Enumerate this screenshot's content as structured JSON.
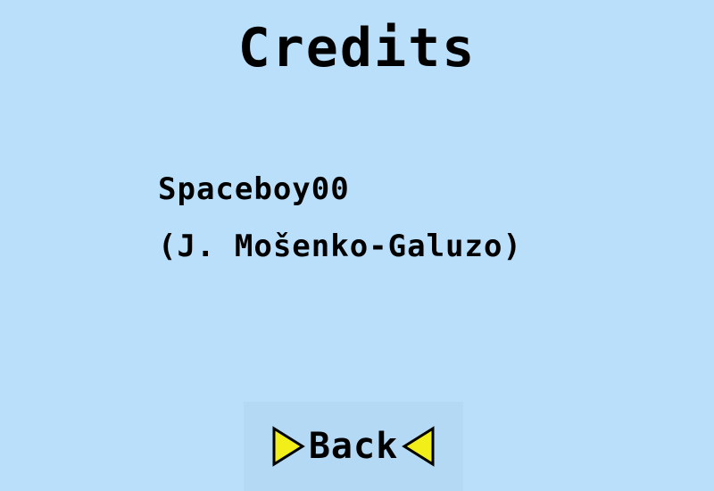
{
  "screen": {
    "title": "Credits",
    "credits": [
      "Spaceboy00",
      "(J. Mošenko-Galuzo)"
    ],
    "back_label": "Back"
  },
  "icons": {
    "left_arrow": "right-pointing-triangle-icon",
    "right_arrow": "left-pointing-triangle-icon"
  },
  "colors": {
    "background": "#b9dffb",
    "button_background": "#b4d9f4",
    "arrow_fill": "#f2ee1a",
    "text": "#000000"
  }
}
